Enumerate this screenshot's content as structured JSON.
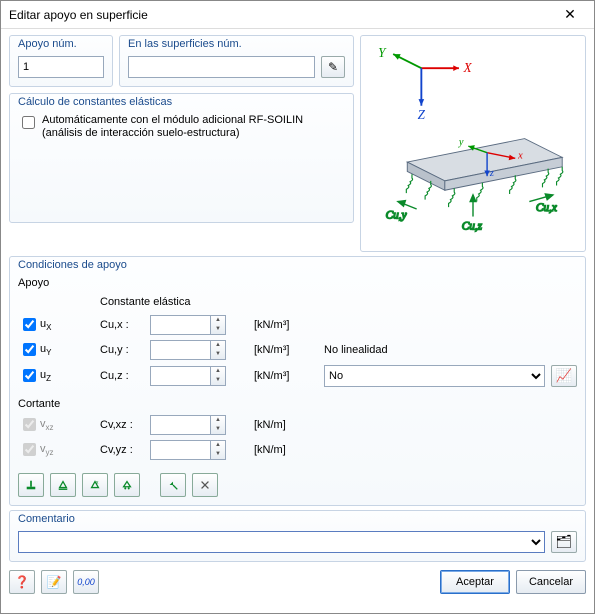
{
  "window": {
    "title": "Editar apoyo en superficie"
  },
  "top": {
    "apoyo_label": "Apoyo núm.",
    "apoyo_value": "1",
    "surfaces_label": "En las superficies núm.",
    "surfaces_value": ""
  },
  "calc": {
    "legend": "Cálculo de constantes elásticas",
    "auto_label": "Automáticamente con el módulo adicional RF-SOILIN",
    "auto_label2": "(análisis de interacción suelo-estructura)",
    "auto_checked": false
  },
  "conditions": {
    "legend": "Condiciones de apoyo",
    "apoyo_head": "Apoyo",
    "const_head": "Constante elástica",
    "rows": [
      {
        "name": "uX",
        "checked": true,
        "enabled": true,
        "clabel": "Cu,x :",
        "value": "",
        "unit": "[kN/m³]"
      },
      {
        "name": "uY",
        "checked": true,
        "enabled": true,
        "clabel": "Cu,y :",
        "value": "",
        "unit": "[kN/m³]"
      },
      {
        "name": "uZ",
        "checked": true,
        "enabled": true,
        "clabel": "Cu,z :",
        "value": "",
        "unit": "[kN/m³]"
      }
    ],
    "cortante_head": "Cortante",
    "cortante_rows": [
      {
        "name": "vxz",
        "checked": true,
        "enabled": false,
        "clabel": "Cv,xz :",
        "value": "",
        "unit": "[kN/m]"
      },
      {
        "name": "vyz",
        "checked": true,
        "enabled": false,
        "clabel": "Cv,yz :",
        "value": "",
        "unit": "[kN/m]"
      }
    ],
    "nl_label": "No linealidad",
    "nl_value": "No"
  },
  "comment": {
    "legend": "Comentario",
    "value": ""
  },
  "buttons": {
    "ok": "Aceptar",
    "cancel": "Cancelar"
  },
  "axes": {
    "x": "X",
    "y": "Y",
    "z": "Z",
    "lx": "x",
    "ly": "y",
    "lz": "z"
  },
  "labels": {
    "cux": "Cu,x",
    "cuy": "Cu,y",
    "cuz": "Cu,z"
  }
}
